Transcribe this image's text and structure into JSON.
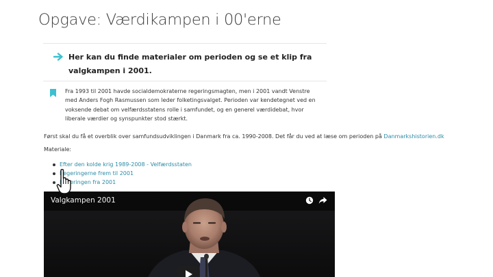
{
  "page": {
    "title": "Opgave: Værdikampen i 00'erne"
  },
  "intro": {
    "text": "Her kan du finde materialer om perioden og se et klip fra valgkampen i 2001."
  },
  "context": {
    "text": "Fra 1993 til 2001 havde socialdemokraterne regeringsmagten, men i 2001 vandt Venstre med Anders Fogh Rasmussen som leder folketingsvalget. Perioden var kendetegnet ved en voksende debat om velfærdsstatens rolle i samfundet, og en generel værdidebat, hvor liberale værdier og synspunkter stod stærkt."
  },
  "lead": {
    "text": "Først skal du få et overblik over samfundsudviklingen i Danmark fra ca. 1990-2008. Det får du ved at læse om perioden på ",
    "link": "Danmarkshistorien.dk"
  },
  "materials": {
    "label": "Materiale:",
    "items": [
      {
        "label": "Efter den kolde krig 1989-2008 - Velfærdsstaten"
      },
      {
        "label": "Regeringerne frem til 2001"
      },
      {
        "label": "Regeringen fra 2001"
      }
    ]
  },
  "video": {
    "title": "Valgkampen 2001"
  },
  "icons": {
    "intro": "arrow-right-icon",
    "context": "bookmark-icon",
    "cursor": "hand-pointer-cursor",
    "watch_later": "clock-icon",
    "share": "share-icon",
    "play": "play-icon"
  },
  "colors": {
    "accent": "#3cc0cf",
    "link": "#2c8ba5",
    "play_button": "#1f1f1f"
  }
}
